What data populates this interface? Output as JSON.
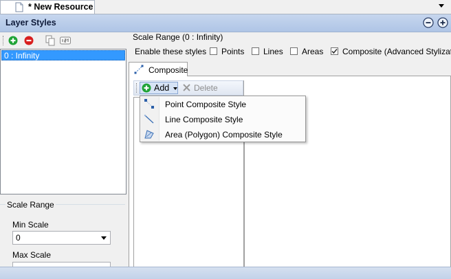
{
  "document_tab": {
    "title": "* New Resource"
  },
  "header": {
    "title": "Layer Styles"
  },
  "scale_ranges": {
    "items": [
      "0 : Infinity"
    ]
  },
  "scale_range_group": {
    "label": "Scale Range",
    "min_scale_label": "Min Scale",
    "min_scale_value": "0",
    "max_scale_label": "Max Scale"
  },
  "style_editor": {
    "title": "Scale Range (0 : Infinity)",
    "enable_label": "Enable these styles",
    "checks": {
      "points": {
        "label": "Points",
        "checked": false
      },
      "lines": {
        "label": "Lines",
        "checked": false
      },
      "areas": {
        "label": "Areas",
        "checked": false
      },
      "composite": {
        "label": "Composite (Advanced Stylization)",
        "checked": true
      }
    },
    "tab_label": "Composite"
  },
  "composite_toolbar": {
    "add_label": "Add",
    "delete_label": "Delete"
  },
  "add_menu": {
    "items": [
      "Point Composite Style",
      "Line Composite Style",
      "Area (Polygon) Composite Style"
    ]
  },
  "colors": {
    "selection": "#3399ff",
    "header": "#c6d6ee",
    "add_green": "#1fa336",
    "remove_red": "#d81e1e"
  }
}
